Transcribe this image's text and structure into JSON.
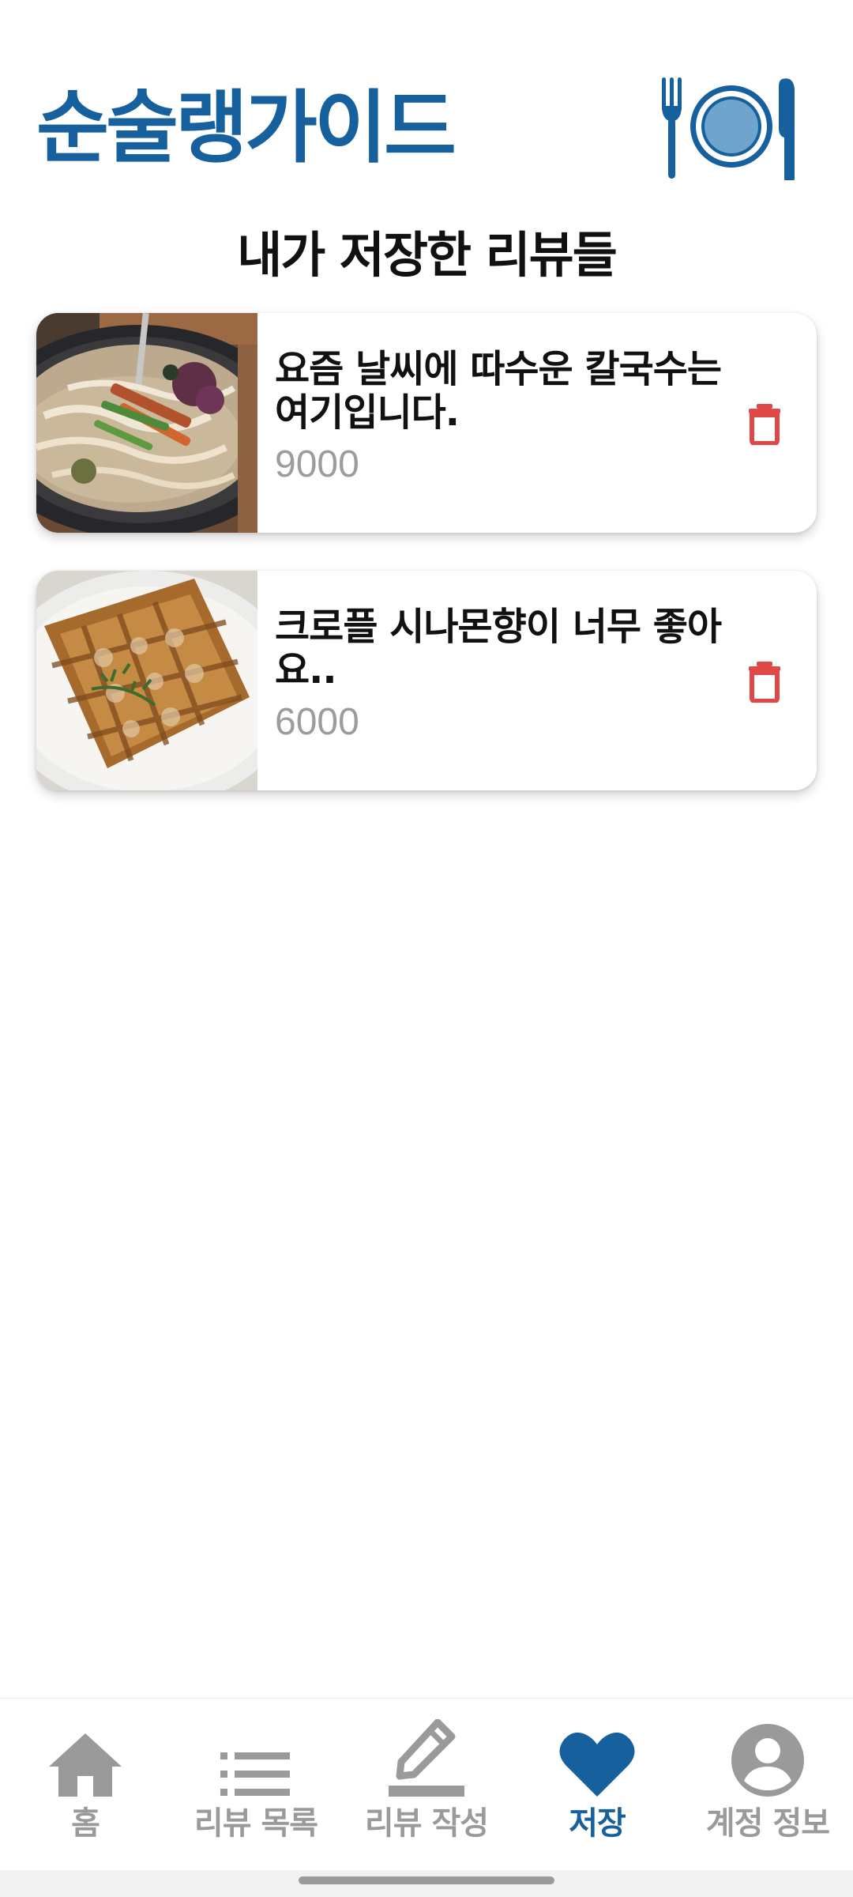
{
  "app": {
    "title": "순술랭가이드",
    "brand_color": "#16609E",
    "logo_icon": "plate-fork-knife-icon"
  },
  "page": {
    "title": "내가 저장한 리뷰들"
  },
  "reviews": [
    {
      "title": "요즘 날씨에 따수운 칼국수는 여기입니다.",
      "price": "9000",
      "image": "kalguksu-photo",
      "action_icon": "trash-icon"
    },
    {
      "title": "크로플 시나몬향이 너무 좋아요..",
      "price": "6000",
      "image": "croffle-photo",
      "action_icon": "trash-icon"
    }
  ],
  "nav": {
    "items": [
      {
        "label": "홈",
        "icon": "home-icon",
        "active": false
      },
      {
        "label": "리뷰 목록",
        "icon": "list-icon",
        "active": false
      },
      {
        "label": "리뷰 작성",
        "icon": "pencil-icon",
        "active": false
      },
      {
        "label": "저장",
        "icon": "heart-icon",
        "active": true
      },
      {
        "label": "계정 정보",
        "icon": "account-icon",
        "active": false
      }
    ],
    "active_color": "#16609E",
    "inactive_color": "#9A9A9A"
  },
  "colors": {
    "delete": "#E04848"
  }
}
